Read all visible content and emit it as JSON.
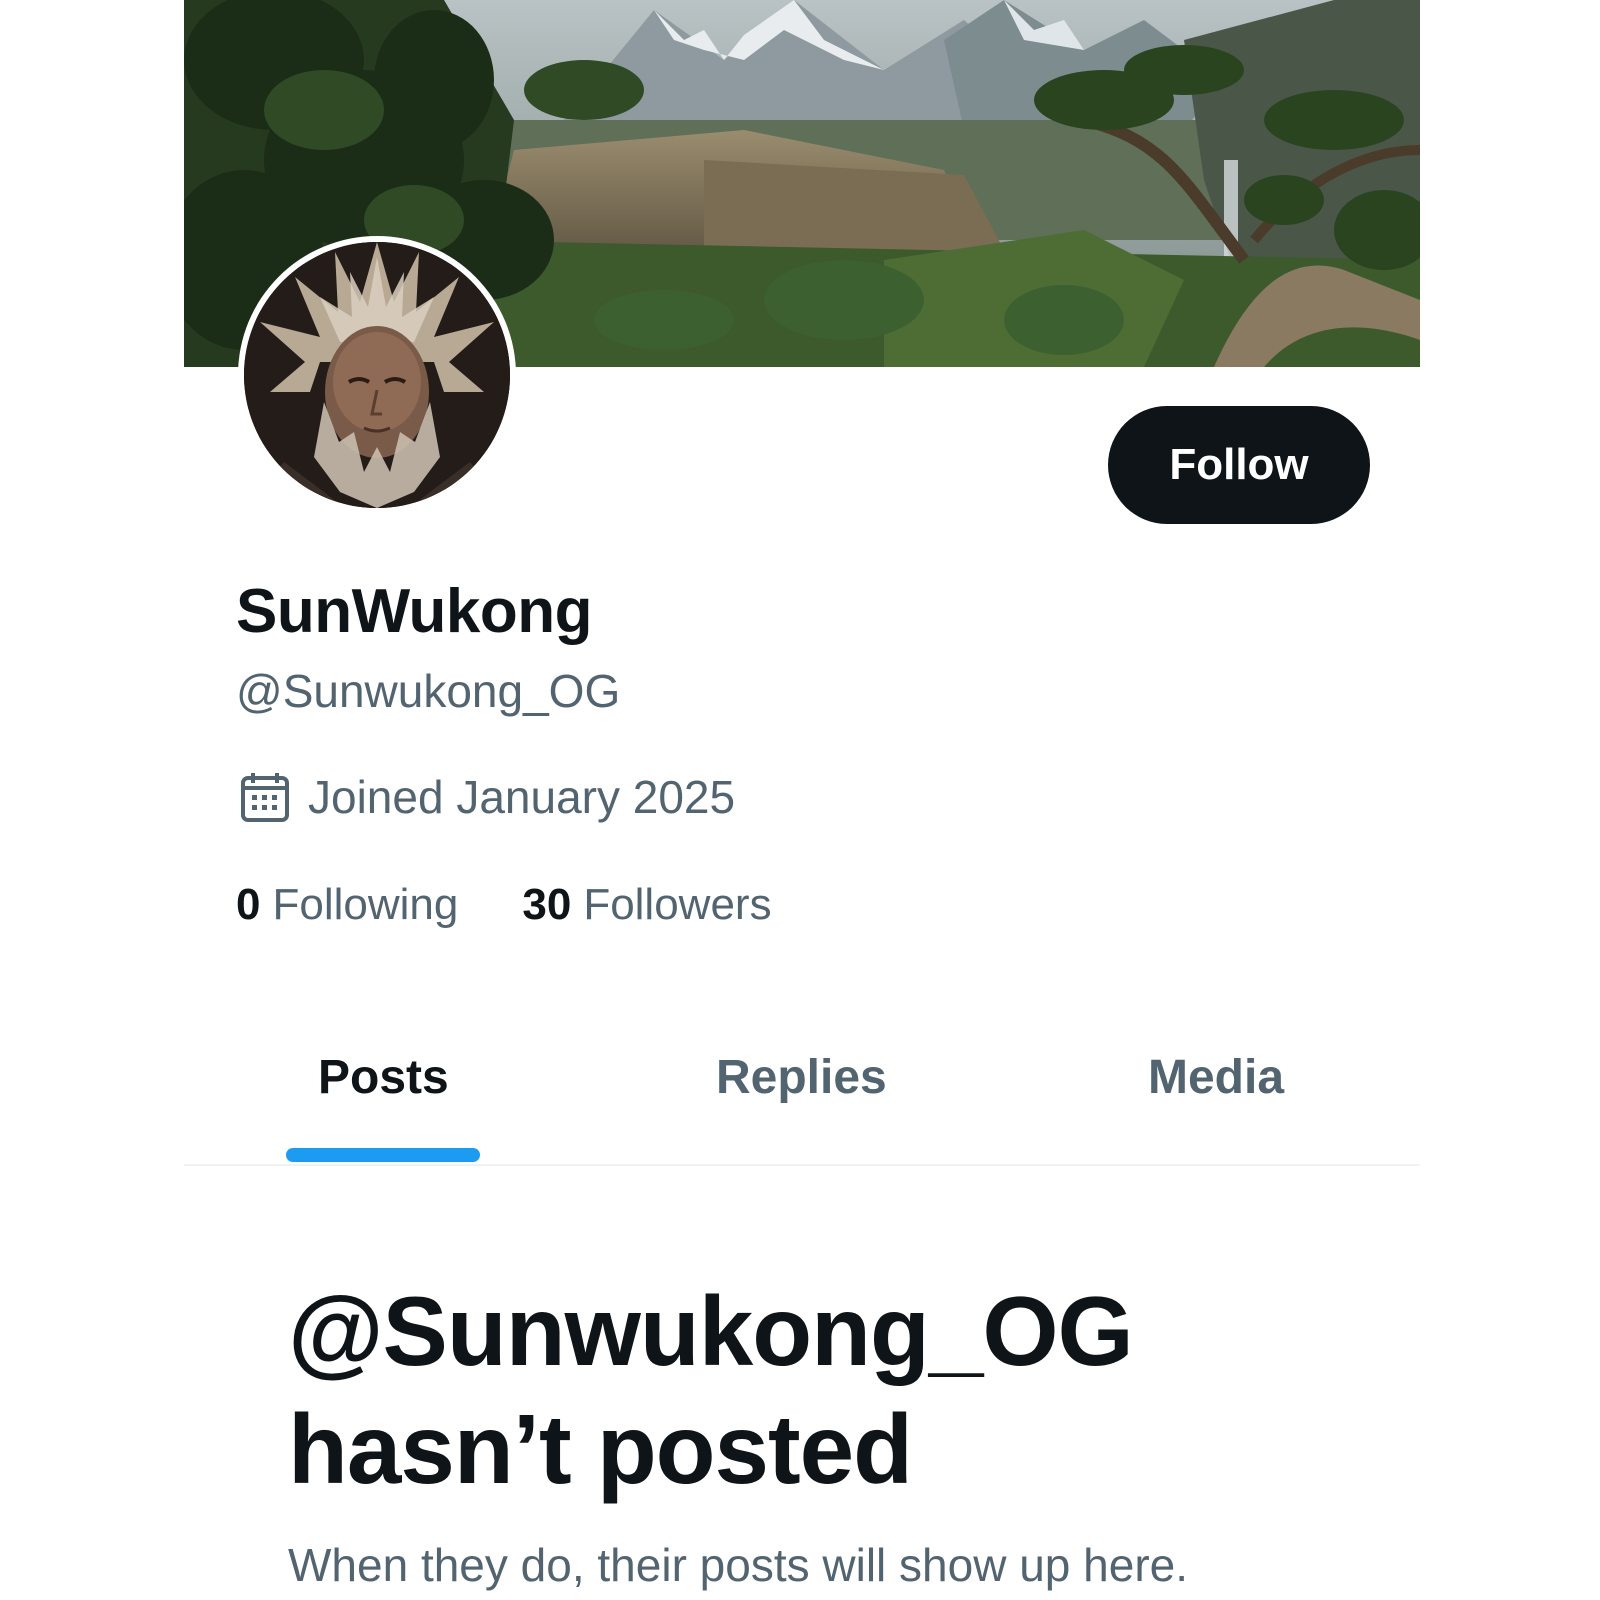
{
  "profile": {
    "display_name": "SunWukong",
    "handle": "@Sunwukong_OG",
    "joined": "Joined January 2025",
    "following_count": "0",
    "following_label": "Following",
    "followers_count": "30",
    "followers_label": "Followers"
  },
  "actions": {
    "follow_label": "Follow"
  },
  "tabs": [
    {
      "label": "Posts",
      "active": true
    },
    {
      "label": "Replies",
      "active": false
    },
    {
      "label": "Media",
      "active": false
    }
  ],
  "empty_state": {
    "title_line1": "@Sunwukong_OG",
    "title_line2": "hasn’t posted",
    "subtitle": "When they do, their posts will show up here."
  },
  "icons": {
    "joined": "calendar-icon"
  },
  "colors": {
    "accent": "#1d9bf0",
    "primary_text": "#0f1419",
    "secondary_text": "#536471",
    "button_bg": "#0f1419"
  }
}
